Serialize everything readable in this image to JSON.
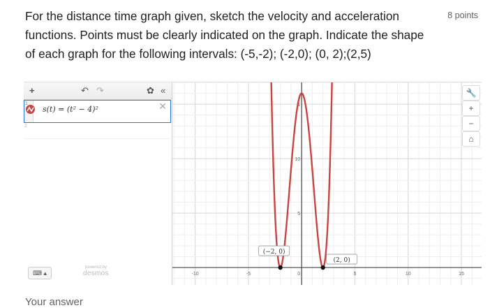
{
  "question": {
    "text": "For the distance time graph given, sketch the velocity and acceleration functions. Points must be clearly indicated on the graph. Indicate the shape of each graph for the following intervals: (-5,-2); (-2,0); (0, 2);(2,5)",
    "points": "8 points"
  },
  "calculator": {
    "toolbar": {
      "add": "+",
      "undo": "↶",
      "redo": "↷",
      "settings": "✿",
      "collapse": "«"
    },
    "expression": {
      "index": "1",
      "latex": "s(t) = (t² − 4)²",
      "close": "✕"
    },
    "empty_index": "2",
    "keypad": "⌨ ▴",
    "powered_by": "powered by",
    "brand": "desmos",
    "right_buttons": [
      "🔧",
      "+",
      "−",
      "⌂"
    ],
    "curve_color": "#c74440",
    "points_labels": [
      "(−2, 0)",
      "(2, 0)"
    ]
  },
  "chart_data": {
    "type": "line",
    "function": "(t^2 - 4)^2",
    "xlim": [
      -12.2,
      16.9
    ],
    "ylim": [
      -1.6,
      17
    ],
    "x_ticks": [
      -10,
      -5,
      0,
      5,
      10,
      15
    ],
    "y_ticks": [
      5,
      10,
      15
    ],
    "x_tick_labels": [
      "-10",
      "-5",
      "0",
      "5",
      "10",
      "15"
    ],
    "y_tick_labels": [
      "5",
      "10",
      "1"
    ],
    "highlighted_points": [
      {
        "x": -2,
        "y": 0,
        "label": "(−2, 0)"
      },
      {
        "x": 2,
        "y": 0,
        "label": "(2, 0)"
      }
    ],
    "grid": true
  },
  "footer": {
    "your_answer": "Your answer"
  }
}
